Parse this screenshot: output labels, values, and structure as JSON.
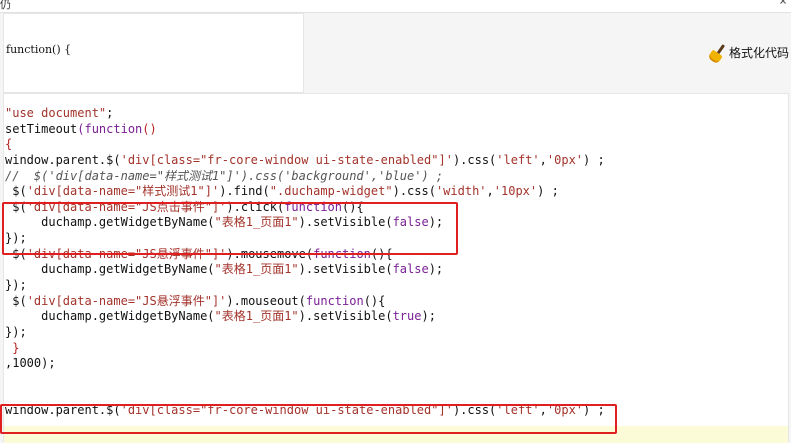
{
  "window": {
    "title_char": "仍",
    "close_char": "×"
  },
  "header": {
    "function_signature": "function() {"
  },
  "toolbar": {
    "format_label": "格式化代码",
    "format_icon": "broom-icon"
  },
  "colors": {
    "keyword": "#7a1f95",
    "string": "#a3332b",
    "brace": "#b32121",
    "highlight": "#e02020",
    "active_line": "#fcfbd7"
  },
  "code_lines": [
    [
      [
        "s",
        "\"use document\""
      ],
      [
        "n",
        ";"
      ]
    ],
    [
      [
        "n",
        "setTimeout"
      ],
      [
        "k",
        "(function"
      ],
      [
        "b",
        "()"
      ]
    ],
    [
      [
        "b",
        "{"
      ]
    ],
    [
      [
        "n",
        "window.parent.$("
      ],
      [
        "s",
        "'div[class=\"fr-core-window ui-state-enabled\"]'"
      ],
      [
        "n",
        ").css("
      ],
      [
        "s",
        "'left'"
      ],
      [
        "n",
        ","
      ],
      [
        "s",
        "'0px'"
      ],
      [
        "n",
        ") ;"
      ]
    ],
    [
      [
        "c",
        "//  $('div[data-name=\"样式测试1\"]').css('background','blue') ;"
      ]
    ],
    [
      [
        "n",
        " $("
      ],
      [
        "s",
        "'div[data-name=\"样式测试1\"]'"
      ],
      [
        "n",
        ").find("
      ],
      [
        "s",
        "\".duchamp-widget\""
      ],
      [
        "n",
        ").css("
      ],
      [
        "s",
        "'width'"
      ],
      [
        "n",
        ","
      ],
      [
        "s",
        "'10px'"
      ],
      [
        "n",
        ") ;"
      ]
    ],
    [
      [
        "n",
        " $("
      ],
      [
        "s",
        "'div[data-name=\"JS点击事件\"]'"
      ],
      [
        "n",
        ").click("
      ],
      [
        "k",
        "function"
      ],
      [
        "n",
        "(){"
      ]
    ],
    [
      [
        "n",
        "     duchamp.getWidgetByName("
      ],
      [
        "s",
        "\"表格1_页面1\""
      ],
      [
        "n",
        ").setVisible("
      ],
      [
        "k",
        "false"
      ],
      [
        "n",
        ");"
      ]
    ],
    [
      [
        "n",
        "});"
      ]
    ],
    [
      [
        "n",
        " $("
      ],
      [
        "s",
        "'div[data-name=\"JS悬浮事件\"]'"
      ],
      [
        "n",
        ").mousemove("
      ],
      [
        "k",
        "function"
      ],
      [
        "n",
        "(){"
      ]
    ],
    [
      [
        "n",
        "     duchamp.getWidgetByName("
      ],
      [
        "s",
        "\"表格1_页面1\""
      ],
      [
        "n",
        ").setVisible("
      ],
      [
        "k",
        "false"
      ],
      [
        "n",
        ");"
      ]
    ],
    [
      [
        "n",
        "});"
      ]
    ],
    [
      [
        "n",
        " $("
      ],
      [
        "s",
        "'div[data-name=\"JS悬浮事件\"]'"
      ],
      [
        "n",
        ").mouseout("
      ],
      [
        "k",
        "function"
      ],
      [
        "n",
        "(){"
      ]
    ],
    [
      [
        "n",
        "     duchamp.getWidgetByName("
      ],
      [
        "s",
        "\"表格1_页面1\""
      ],
      [
        "n",
        ").setVisible("
      ],
      [
        "k",
        "true"
      ],
      [
        "n",
        ");"
      ]
    ],
    [
      [
        "n",
        "});"
      ]
    ],
    [
      [
        "b",
        " }"
      ]
    ],
    [
      [
        "n",
        ",1000);"
      ]
    ],
    [
      [
        "n",
        ""
      ]
    ],
    [
      [
        "n",
        ""
      ]
    ],
    [
      [
        "n",
        "window.parent.$("
      ],
      [
        "s",
        "'div[class=\"fr-core-window ui-state-enabled\"]'"
      ],
      [
        "n",
        ").css("
      ],
      [
        "s",
        "'left'"
      ],
      [
        "n",
        ","
      ],
      [
        "s",
        "'0px'"
      ],
      [
        "n",
        ") ;"
      ]
    ],
    [
      [
        "n",
        ""
      ]
    ]
  ]
}
